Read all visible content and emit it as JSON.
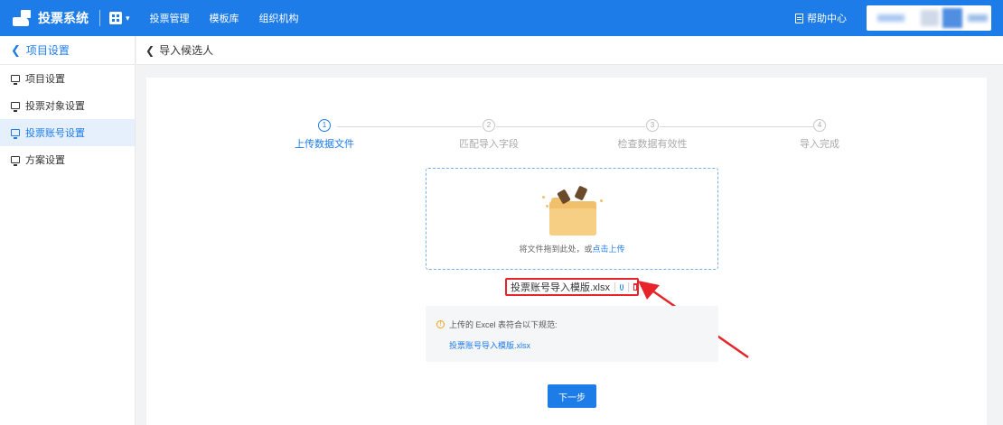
{
  "header": {
    "brand_title": "投票系统",
    "nav": [
      "投票管理",
      "模板库",
      "组织机构"
    ],
    "help_label": "帮助中心"
  },
  "sidebar": {
    "back_label": "项目设置",
    "items": [
      {
        "label": "项目设置",
        "active": false
      },
      {
        "label": "投票对象设置",
        "active": false
      },
      {
        "label": "投票账号设置",
        "active": true
      },
      {
        "label": "方案设置",
        "active": false
      }
    ]
  },
  "breadcrumb": {
    "back_label": "导入候选人"
  },
  "steps": [
    {
      "num": "1",
      "label": "上传数据文件",
      "active": true
    },
    {
      "num": "2",
      "label": "匹配导入字段",
      "active": false
    },
    {
      "num": "3",
      "label": "检查数据有效性",
      "active": false
    },
    {
      "num": "4",
      "label": "导入完成",
      "active": false
    }
  ],
  "upload": {
    "hint_prefix": "将文件拖到此处，或",
    "hint_link": "点击上传",
    "file_name": "投票账号导入模版.xlsx"
  },
  "rules": {
    "title": "上传的 Excel 表符合以下规范:",
    "template_link": "投票账号导入模版.xlsx"
  },
  "next_button": "下一步",
  "colors": {
    "primary": "#1e7ce8",
    "highlight": "#e8242b",
    "warning": "#f0a020"
  }
}
